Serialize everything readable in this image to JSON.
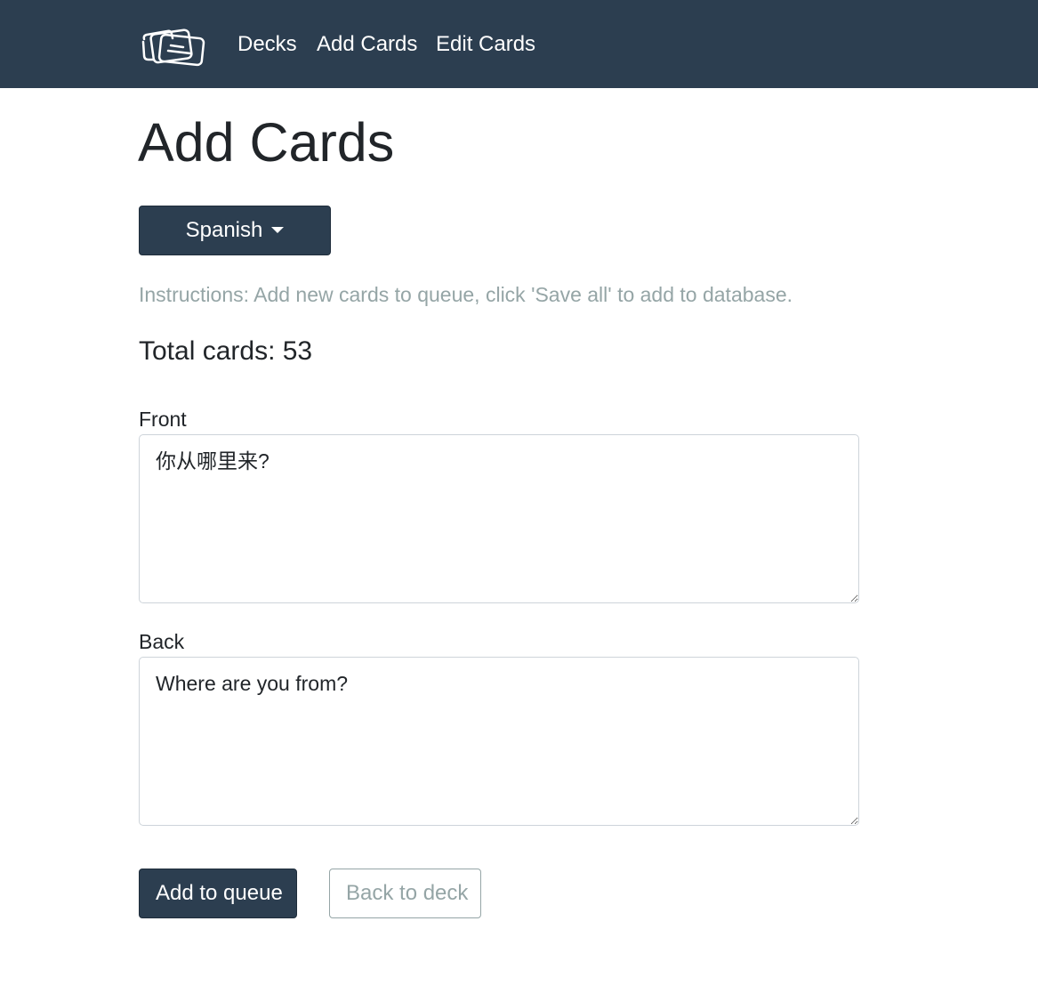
{
  "nav": {
    "brand_icon": "cards-icon",
    "links": [
      {
        "label": "Decks"
      },
      {
        "label": "Add Cards"
      },
      {
        "label": "Edit Cards"
      }
    ]
  },
  "page": {
    "title": "Add Cards",
    "deck_selector": {
      "selected": "Spanish"
    },
    "instructions": "Instructions: Add new cards to queue, click 'Save all' to add to database.",
    "total_cards": "Total cards: 53"
  },
  "form": {
    "front": {
      "label": "Front",
      "value": "你从哪里来?"
    },
    "back": {
      "label": "Back",
      "value": "Where are you from?"
    }
  },
  "actions": {
    "add_to_queue": "Add to queue",
    "back_to_deck": "Back to deck"
  },
  "colors": {
    "primary": "#2c3e50",
    "muted": "#95a5a6",
    "text": "#212529"
  }
}
